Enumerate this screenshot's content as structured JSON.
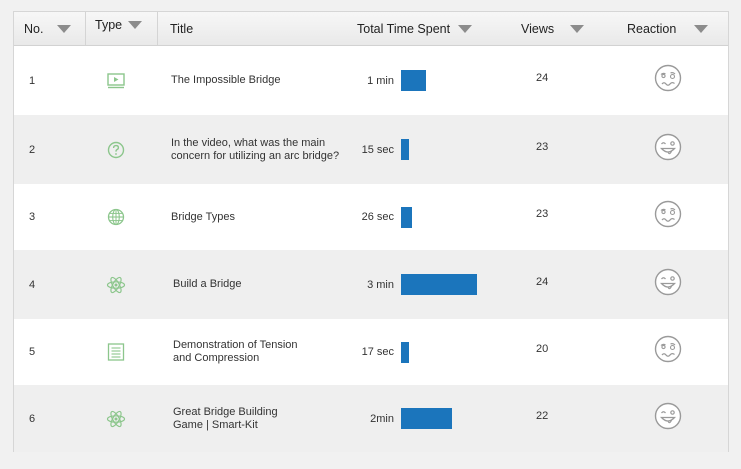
{
  "header": {
    "no": "No.",
    "type": "Type",
    "title": "Title",
    "time": "Total Time Spent",
    "views": "Views",
    "reaction": "Reaction"
  },
  "colors": {
    "bar": "#1b75bc",
    "icon": "#8cc68c",
    "face": "#9a9a9a"
  },
  "rows": [
    {
      "no": "1",
      "type_icon": "video-icon",
      "title": "The Impossible Bridge",
      "time": "1 min",
      "time_seconds": 60,
      "views": "24",
      "reaction": "confused-face-icon"
    },
    {
      "no": "2",
      "type_icon": "question-icon",
      "title": "In the video, what was the main\nconcern for utilizing an arc bridge?",
      "time": "15 sec",
      "time_seconds": 15,
      "views": "23",
      "reaction": "happy-face-icon"
    },
    {
      "no": "3",
      "type_icon": "globe-icon",
      "title": "Bridge Types",
      "time": "26 sec",
      "time_seconds": 26,
      "views": "23",
      "reaction": "confused-face-icon"
    },
    {
      "no": "4",
      "type_icon": "atom-icon",
      "title": "Build a Bridge",
      "time": "3 min",
      "time_seconds": 180,
      "views": "24",
      "reaction": "happy-face-icon"
    },
    {
      "no": "5",
      "type_icon": "document-icon",
      "title": "Demonstration of Tension\nand Compression",
      "time": "17 sec",
      "time_seconds": 17,
      "views": "20",
      "reaction": "confused-face-icon"
    },
    {
      "no": "6",
      "type_icon": "atom-icon",
      "title": "Great Bridge Building\nGame | Smart-Kit",
      "time": "2min",
      "time_seconds": 120,
      "views": "22",
      "reaction": "happy-face-icon"
    }
  ]
}
